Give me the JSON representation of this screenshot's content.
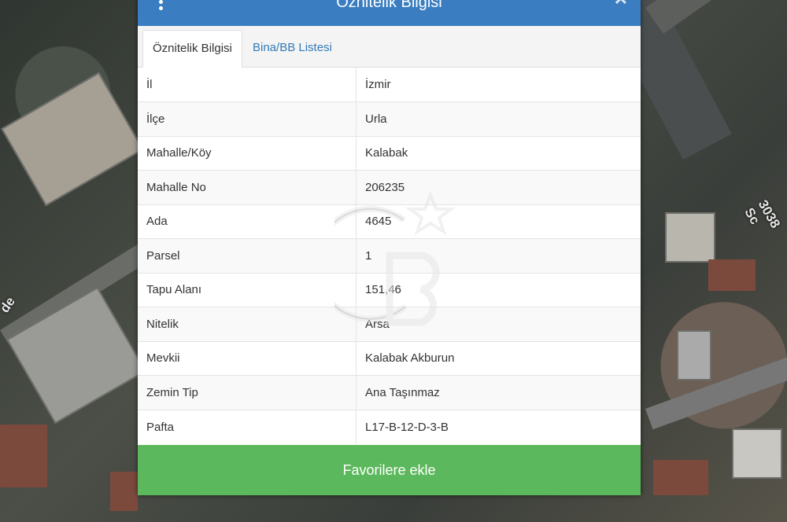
{
  "dialog": {
    "title": "Öznitelik Bilgisi",
    "menu_icon": "vertical-dots-icon",
    "close_icon": "close-icon"
  },
  "tabs": [
    {
      "label": "Öznitelik Bilgisi",
      "active": true
    },
    {
      "label": "Bina/BB Listesi",
      "active": false
    }
  ],
  "attributes": [
    {
      "key": "İl",
      "value": "İzmir"
    },
    {
      "key": "İlçe",
      "value": "Urla"
    },
    {
      "key": "Mahalle/Köy",
      "value": "Kalabak"
    },
    {
      "key": "Mahalle No",
      "value": "206235"
    },
    {
      "key": "Ada",
      "value": "4645"
    },
    {
      "key": "Parsel",
      "value": "1"
    },
    {
      "key": "Tapu Alanı",
      "value": "151,46"
    },
    {
      "key": "Nitelik",
      "value": "Arsa"
    },
    {
      "key": "Mevkii",
      "value": "Kalabak Akburun"
    },
    {
      "key": "Zemin Tip",
      "value": "Ana Taşınmaz"
    },
    {
      "key": "Pafta",
      "value": "L17-B-12-D-3-B"
    }
  ],
  "footer": {
    "favorite_label": "Favorilere ekle"
  },
  "map": {
    "street_label": "3038 Sc",
    "left_label": "de"
  },
  "colors": {
    "header": "#3a7dc0",
    "button": "#5cb85c",
    "link": "#337ab7"
  }
}
